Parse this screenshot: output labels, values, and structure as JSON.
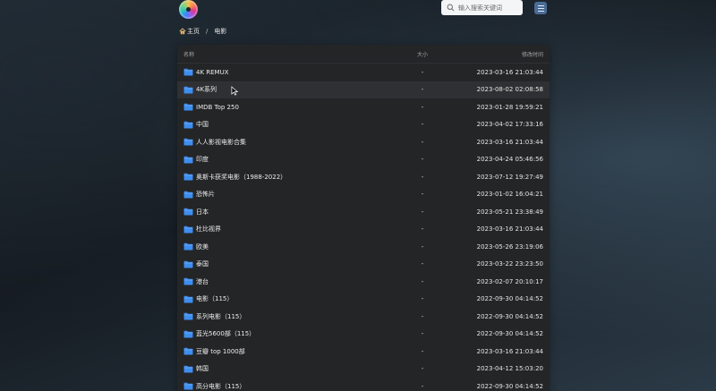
{
  "header": {
    "search_placeholder": "输入搜索关键词"
  },
  "breadcrumb": {
    "home": "主页",
    "separator": "/",
    "current": "电影"
  },
  "table": {
    "columns": {
      "name": "名称",
      "size": "大小",
      "modified": "修改时间"
    },
    "rows": [
      {
        "name": "4K REMUX",
        "size": "-",
        "modified": "2023-03-16 21:03:44"
      },
      {
        "name": "4K系列",
        "size": "-",
        "modified": "2023-08-02 02:08:58"
      },
      {
        "name": "IMDB Top 250",
        "size": "-",
        "modified": "2023-01-28 19:59:21"
      },
      {
        "name": "中国",
        "size": "-",
        "modified": "2023-04-02 17:33:16"
      },
      {
        "name": "人人影视电影合集",
        "size": "-",
        "modified": "2023-03-16 21:03:44"
      },
      {
        "name": "印度",
        "size": "-",
        "modified": "2023-04-24 05:46:56"
      },
      {
        "name": "奥斯卡获奖电影（1988-2022）",
        "size": "-",
        "modified": "2023-07-12 19:27:49"
      },
      {
        "name": "恐怖片",
        "size": "-",
        "modified": "2023-01-02 16:04:21"
      },
      {
        "name": "日本",
        "size": "-",
        "modified": "2023-05-21 23:38:49"
      },
      {
        "name": "杜比视界",
        "size": "-",
        "modified": "2023-03-16 21:03:44"
      },
      {
        "name": "欧美",
        "size": "-",
        "modified": "2023-05-26 23:19:06"
      },
      {
        "name": "泰国",
        "size": "-",
        "modified": "2023-03-22 23:23:50"
      },
      {
        "name": "港台",
        "size": "-",
        "modified": "2023-02-07 20:10:17"
      },
      {
        "name": "电影（115）",
        "size": "-",
        "modified": "2022-09-30 04:14:52"
      },
      {
        "name": "系列电影（115）",
        "size": "-",
        "modified": "2022-09-30 04:14:52"
      },
      {
        "name": "蓝光5600部（115）",
        "size": "-",
        "modified": "2022-09-30 04:14:52"
      },
      {
        "name": "豆瓣 top 1000部",
        "size": "-",
        "modified": "2023-03-16 21:03:44"
      },
      {
        "name": "韩国",
        "size": "-",
        "modified": "2023-04-12 15:03:20"
      },
      {
        "name": "高分电影（115）",
        "size": "-",
        "modified": "2022-09-30 04:14:52"
      }
    ]
  },
  "colors": {
    "folder": "#3d8ef0",
    "panel": "#242527",
    "row_hover": "#2f3033",
    "menu_button": "#4b6b96"
  },
  "icons": [
    "logo",
    "search-icon",
    "menu-icon",
    "home-icon",
    "folder-icon",
    "cursor-icon"
  ]
}
